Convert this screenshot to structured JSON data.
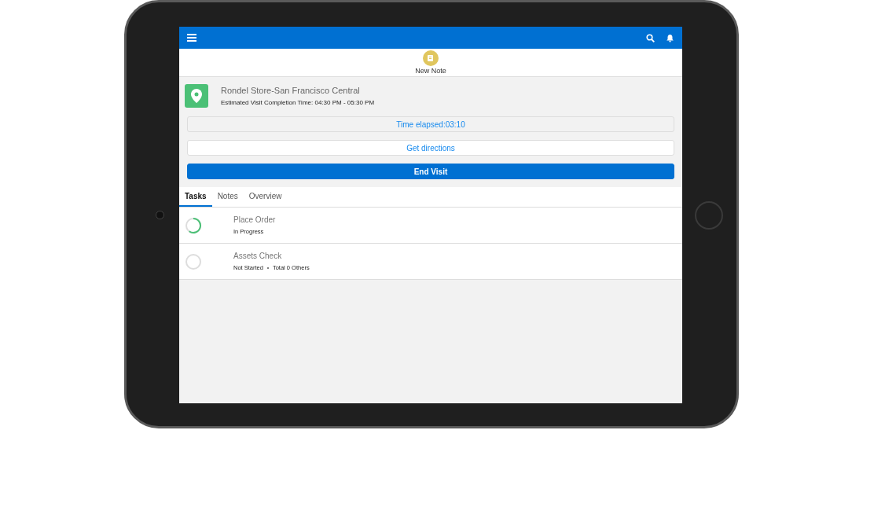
{
  "action": {
    "label": "New Note"
  },
  "visit": {
    "store": "Rondel Store-San Francisco Central",
    "estimate": "Estimated Visit Completion Time: 04:30 PM - 05:30 PM",
    "elapsed": "Time elapsed:03:10",
    "directions": "Get directions",
    "end": "End Visit"
  },
  "tabs": [
    {
      "label": "Tasks",
      "selected": true
    },
    {
      "label": "Notes",
      "selected": false
    },
    {
      "label": "Overview",
      "selected": false
    }
  ],
  "tasks": [
    {
      "title": "Place Order",
      "level": 0.6,
      "meta": [
        "In Progress"
      ]
    },
    {
      "title": "Assets Check",
      "meta": [
        "Not Started",
        "Total 0 Others"
      ]
    }
  ]
}
